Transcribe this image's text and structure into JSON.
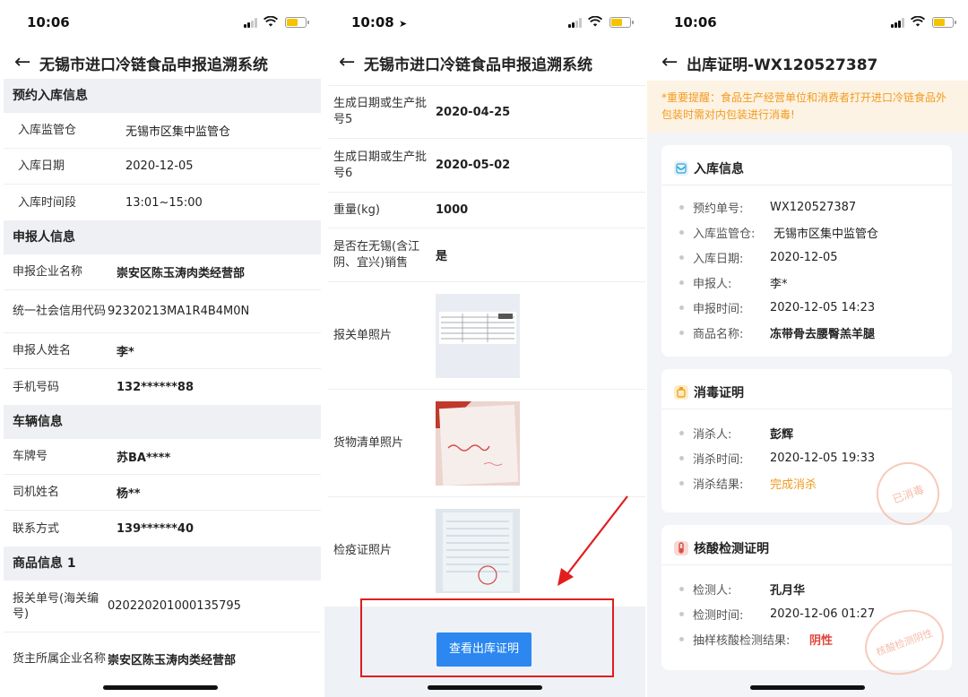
{
  "phone1": {
    "time": "10:06",
    "title": "无锡市进口冷链食品申报追溯系统",
    "sections": [
      {
        "title": "预约入库信息",
        "rows": [
          {
            "label": "入库监管仓",
            "value": "无锡市区集中监管仓"
          },
          {
            "label": "入库日期",
            "value": "2020-12-05"
          },
          {
            "label": "入库时间段",
            "value": "13:01~15:00"
          }
        ]
      },
      {
        "title": "申报人信息",
        "rows": [
          {
            "label": "申报企业名称",
            "value": "崇安区陈玉涛肉类经营部"
          },
          {
            "label": "统一社会信用代码",
            "value": "92320213MA1R4B4M0N"
          },
          {
            "label": "申报人姓名",
            "value": "李*"
          },
          {
            "label": "手机号码",
            "value": "132******88"
          }
        ]
      },
      {
        "title": "车辆信息",
        "rows": [
          {
            "label": "车牌号",
            "value": "苏BA****"
          },
          {
            "label": "司机姓名",
            "value": "杨**"
          },
          {
            "label": "联系方式",
            "value": "139******40"
          }
        ]
      },
      {
        "title": "商品信息 1",
        "rows": [
          {
            "label": "报关单号(海关编号)",
            "value": "020220201000135795"
          },
          {
            "label": "货主所属企业名称",
            "value": "崇安区陈玉涛肉类经营部"
          }
        ]
      }
    ]
  },
  "phone2": {
    "time": "10:08",
    "title": "无锡市进口冷链食品申报追溯系统",
    "rows": [
      {
        "label": "生成日期或生产批号5",
        "value": "2020-04-25"
      },
      {
        "label": "生成日期或生产批号6",
        "value": "2020-05-02"
      },
      {
        "label": "重量(kg)",
        "value": "1000"
      },
      {
        "label": "是否在无锡(含江阴、宜兴)销售",
        "value": "是"
      }
    ],
    "photos": [
      {
        "label": "报关单照片"
      },
      {
        "label": "货物清单照片"
      },
      {
        "label": "检疫证照片"
      }
    ],
    "button": "查看出库证明"
  },
  "phone3": {
    "time": "10:06",
    "title": "出库证明-WX120527387",
    "notice": "*重要提醒：食品生产经营单位和消费者打开进口冷链食品外包装时需对内包装进行消毒!",
    "inbound": {
      "title": "入库信息",
      "items": [
        {
          "k": "预约单号:",
          "v": "WX120527387"
        },
        {
          "k": "入库监管仓:",
          "v": "无锡市区集中监管仓"
        },
        {
          "k": "入库日期:",
          "v": "2020-12-05"
        },
        {
          "k": "申报人:",
          "v": "李*"
        },
        {
          "k": "申报时间:",
          "v": "2020-12-05 14:23"
        },
        {
          "k": "商品名称:",
          "v": "冻带骨去腰臀羔羊腿"
        }
      ]
    },
    "disinfect": {
      "title": "消毒证明",
      "items": [
        {
          "k": "消杀人:",
          "v": "彭辉"
        },
        {
          "k": "消杀时间:",
          "v": "2020-12-05 19:33"
        },
        {
          "k": "消杀结果:",
          "v": "完成消杀"
        }
      ],
      "stamp": "已消毒"
    },
    "nucleic": {
      "title": "核酸检测证明",
      "items": [
        {
          "k": "检测人:",
          "v": "孔月华"
        },
        {
          "k": "检测时间:",
          "v": "2020-12-06 01:27"
        },
        {
          "k": "抽样核酸检测结果:",
          "v": "阴性"
        }
      ],
      "stamp": "核酸检测阴性"
    }
  },
  "colors": {
    "accent": "#2c87f0",
    "warning": "#f19b1f",
    "negative": "#e0463a",
    "highlight": "#e21d1d"
  }
}
